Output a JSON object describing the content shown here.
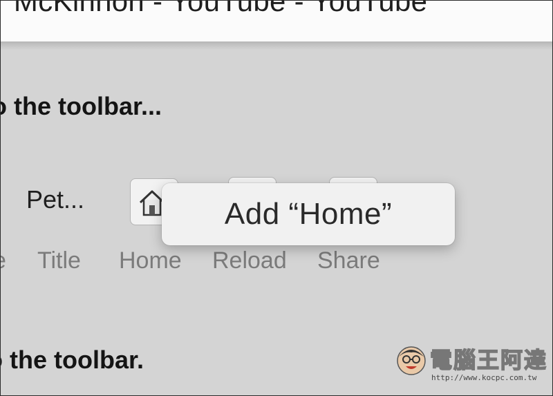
{
  "window": {
    "title_fragment": "er McKinnon - YouTube - YouTube"
  },
  "customize": {
    "heading_top": "o the toolbar...",
    "heading_bottom": "o the toolbar.",
    "toolbar_title_item": "Pet...",
    "tooltip_text": "Add “Home”",
    "labels": [
      "e",
      "Title",
      "Home",
      "Reload",
      "Share"
    ]
  },
  "icons": {
    "home_button": "house-icon"
  },
  "watermark": {
    "logo_text": "電腦王阿達",
    "url": "http://www.kocpc.com.tw"
  },
  "colors": {
    "background": "#d4d4d4",
    "label_gray": "#7b7b7b",
    "tooltip_bg": "#f1f1f1"
  }
}
